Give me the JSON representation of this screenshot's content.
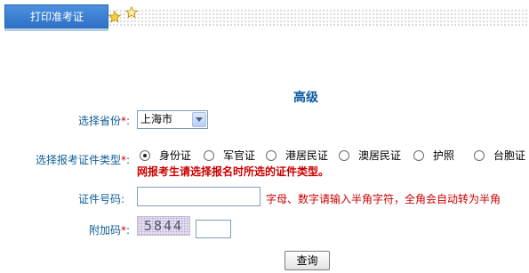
{
  "tabs": {
    "active_label": "打印准考证"
  },
  "form": {
    "title": "高级",
    "province": {
      "label": "选择省份",
      "required_mark": "*",
      "colon": ":",
      "value": "上海市"
    },
    "id_type": {
      "label": "选择报考证件类型",
      "required_mark": "*",
      "colon": ":",
      "options": [
        "身份证",
        "军官证",
        "港居民证",
        "澳居民证",
        "护照",
        "台胞证"
      ],
      "selected": "身份证",
      "warning": "网报考生请选择报名时所选的证件类型。"
    },
    "id_number": {
      "label": "证件号码",
      "colon": ":",
      "value": "",
      "hint": "字母、数字请输入半角字符，全角会自动转为半角"
    },
    "captcha": {
      "label": "附加码",
      "required_mark": "*",
      "colon": ":",
      "code": "5844",
      "value": ""
    },
    "submit_label": "查询"
  },
  "icons": [
    "star-icon",
    "star-icon",
    "dropdown-arrow-icon"
  ],
  "colors": {
    "tab_blue": "#3a7fd4",
    "label_blue": "#0f5e9a",
    "title_blue": "#0b5aa3",
    "warning_red": "#cc0000"
  }
}
